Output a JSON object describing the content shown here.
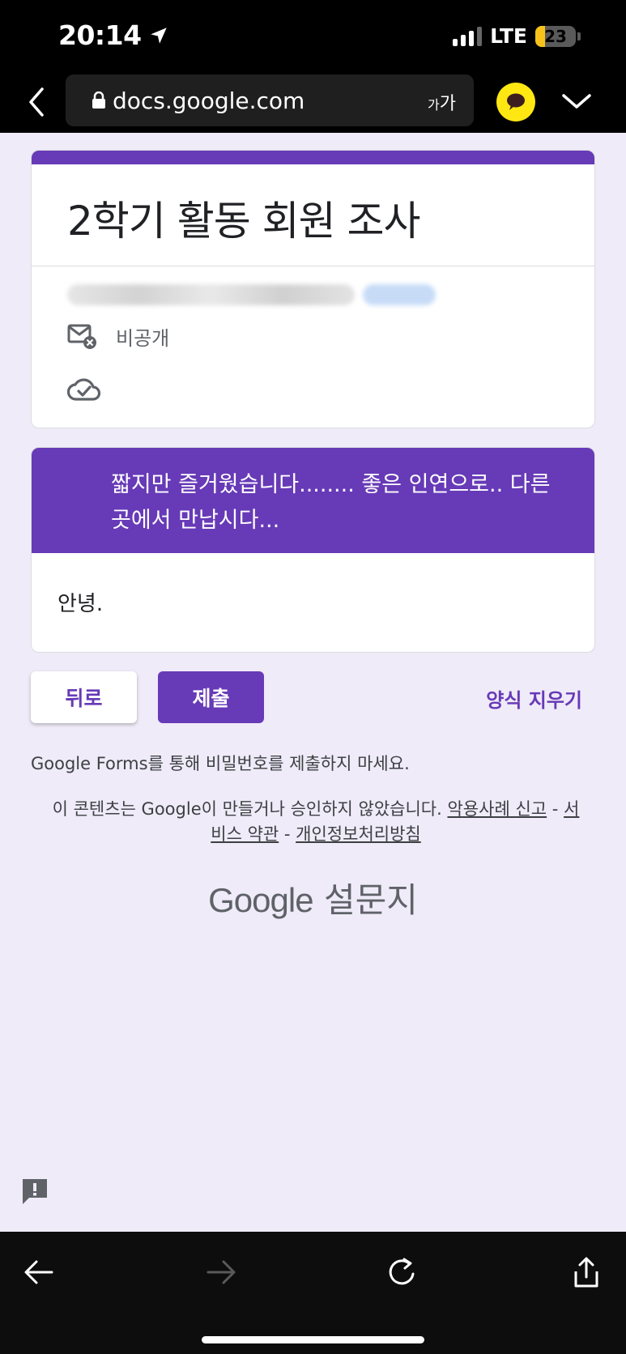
{
  "status_bar": {
    "time": "20:14",
    "network": "LTE",
    "battery": "23"
  },
  "browser": {
    "url": "docs.google.com",
    "text_size_label_small": "가",
    "text_size_label_large": "가"
  },
  "form": {
    "title": "2학기 활동 회원 조사",
    "privacy_label": "비공개",
    "section_description": "짧지만 즐거웠습니다........ 좋은 인연으로.. 다른 곳에서 만납시다...",
    "section_body": "안녕."
  },
  "actions": {
    "back_label": "뒤로",
    "submit_label": "제출",
    "clear_label": "양식 지우기"
  },
  "footer": {
    "password_warning": "Google Forms를 통해 비밀번호를 제출하지 마세요.",
    "disclaimer_prefix": "이 콘텐츠는 Google이 만들거나 승인하지 않았습니다.",
    "report_link": "악용사례 신고",
    "separator": "-",
    "terms_link": "서비스 약관",
    "privacy_link": "개인정보처리방침",
    "brand_google": "Google",
    "brand_product": "설문지"
  },
  "colors": {
    "accent": "#673ab7",
    "background": "#efebf8"
  }
}
